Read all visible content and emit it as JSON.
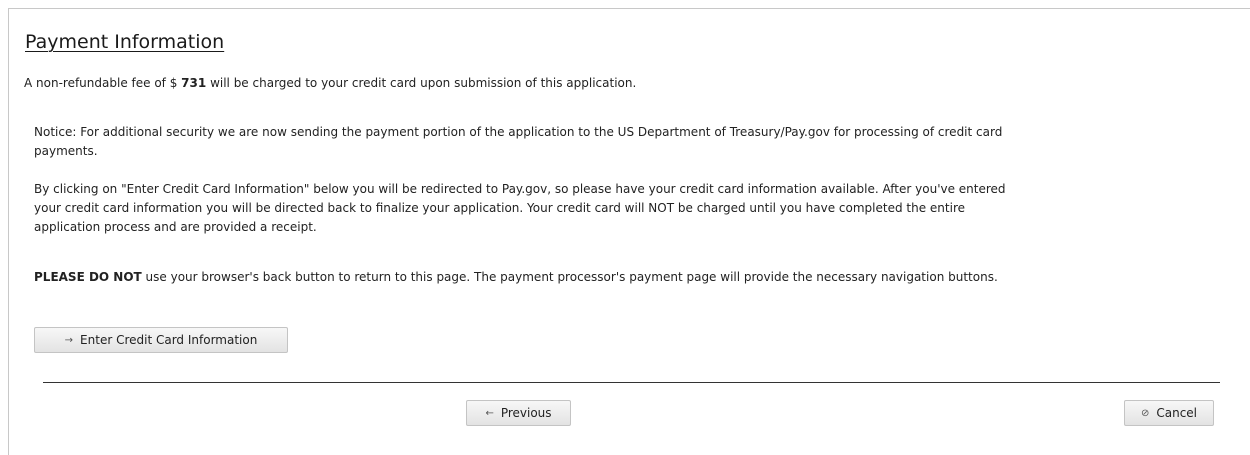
{
  "payment": {
    "title": "Payment Information",
    "fee_prefix": "A non-refundable fee of $",
    "fee_amount": "731",
    "fee_suffix": "will be charged to your credit card upon submission of this application."
  },
  "notices": {
    "notice": "Notice: For additional security we are now sending the payment portion of the application to the US Department of Treasury/Pay.gov for processing of credit card payments.",
    "redirect": "By clicking on \"Enter Credit Card Information\" below you will be redirected to Pay.gov, so please have your credit card information available. After you've entered your credit card information you will be directed back to finalize your application. Your credit card will NOT be charged until you have completed the entire application process and are provided a receipt.",
    "warning_bold": "PLEASE DO NOT",
    "warning_rest": "use your browser's back button to return to this page. The payment processor's payment page will provide the necessary navigation buttons."
  },
  "buttons": {
    "enter_cc_icon": "→",
    "enter_cc_icon_name": "arrow-right-icon",
    "enter_cc_label": "Enter Credit Card Information",
    "previous_icon": "←",
    "previous_icon_name": "arrow-left-icon",
    "previous_label": "Previous",
    "cancel_icon": "⊘",
    "cancel_icon_name": "cancel-circle-icon",
    "cancel_label": "Cancel"
  }
}
